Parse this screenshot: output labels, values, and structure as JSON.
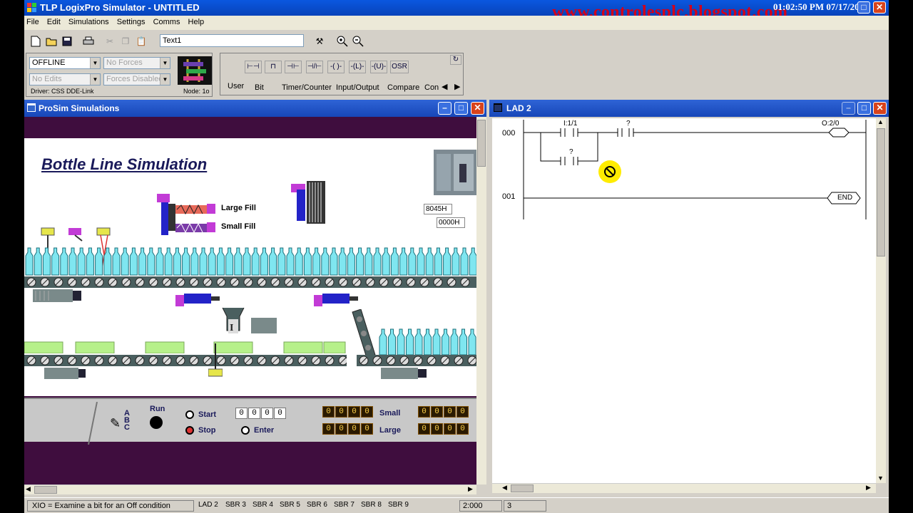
{
  "app": {
    "title": "TLP LogixPro Simulator  -  UNTITLED",
    "watermark": "www.controlesplc.blogspot.com",
    "clock": "01:02:50 PM 07/17/2010"
  },
  "menu": [
    "File",
    "Edit",
    "Simulations",
    "Settings",
    "Comms",
    "Help"
  ],
  "toolbar": {
    "text_field": "Text1"
  },
  "status_panel": {
    "mode": "OFFLINE",
    "forces": "No Forces",
    "edits": "No Edits",
    "forces_state": "Forces Disabled",
    "driver": "Driver: CSS DDE-Link",
    "node": "Node: 1o"
  },
  "palette": {
    "osr": "OSR",
    "tabs": [
      "User",
      "Bit",
      "Timer/Counter",
      "Input/Output",
      "Compare",
      "Con"
    ]
  },
  "prosim": {
    "title": "ProSim Simulations",
    "scene_title": "Bottle Line Simulation",
    "large_fill": "Large Fill",
    "small_fill": "Small Fill",
    "hex1": "8045H",
    "hex2": "0000H",
    "abc": [
      "A",
      "B",
      "C"
    ],
    "run": "Run",
    "start": "Start",
    "stop": "Stop",
    "enter": "Enter",
    "small": "Small",
    "large": "Large",
    "counter_digits": [
      "0",
      "0",
      "0",
      "0"
    ],
    "thumbwheel": [
      "0",
      "0",
      "0",
      "0"
    ]
  },
  "lad": {
    "title": "LAD 2",
    "rung0": "000",
    "rung1": "001",
    "addr_i11": "I:1/1",
    "addr_q1": "?",
    "addr_q2": "?",
    "addr_o20": "O:2/0",
    "end": "END"
  },
  "statusbar": {
    "message": "XIO = Examine a bit for an Off condition",
    "tabs": [
      "LAD 2",
      "SBR 3",
      "SBR 4",
      "SBR 5",
      "SBR 6",
      "SBR 7",
      "SBR 8",
      "SBR 9"
    ],
    "position": "2:000",
    "count": "3"
  },
  "colors": {
    "titlebar": "#0843b9",
    "scene_bg": "#3f0d3e",
    "watermark": "#d4001a"
  }
}
